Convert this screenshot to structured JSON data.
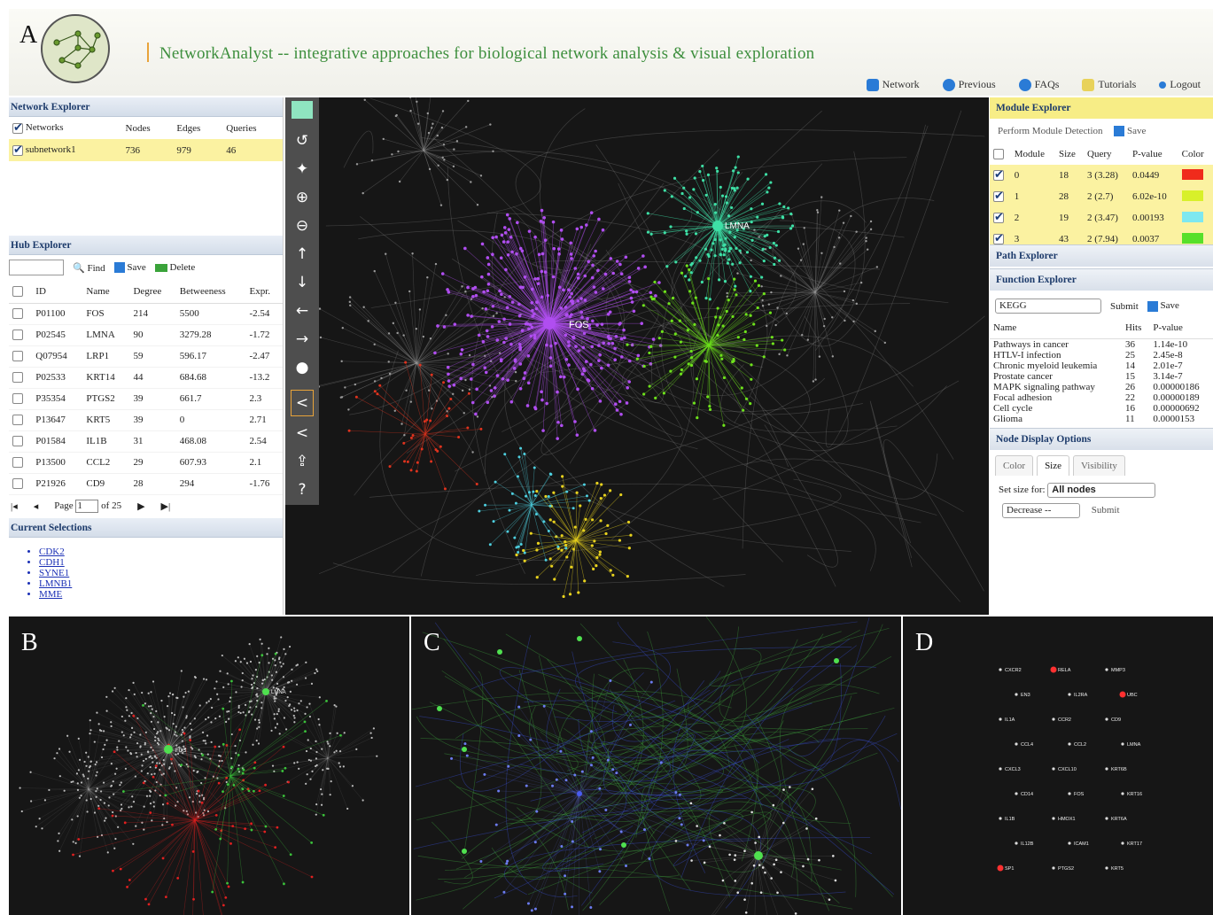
{
  "header": {
    "panel_letter": "A",
    "title": "NetworkAnalyst -- integrative approaches for biological network analysis & visual exploration",
    "nav": [
      {
        "label": "Network",
        "icon": "network-icon",
        "color": "#2a7bd6"
      },
      {
        "label": "Previous",
        "icon": "back-icon",
        "color": "#2a7bd6"
      },
      {
        "label": "FAQs",
        "icon": "help-icon",
        "color": "#2a7bd6"
      },
      {
        "label": "Tutorials",
        "icon": "document-icon",
        "color": "#e8d25a"
      },
      {
        "label": "Logout",
        "icon": "logout-icon",
        "color": "#2a7bd6"
      }
    ]
  },
  "network_explorer": {
    "title": "Network Explorer",
    "columns": [
      "Networks",
      "Nodes",
      "Edges",
      "Queries"
    ],
    "rows": [
      {
        "name": "subnetwork1",
        "nodes": "736",
        "edges": "979",
        "queries": "46"
      }
    ]
  },
  "hub_explorer": {
    "title": "Hub Explorer",
    "find_label": "Find",
    "save_label": "Save",
    "delete_label": "Delete",
    "columns": [
      "ID",
      "Name",
      "Degree",
      "Betweeness",
      "Expr."
    ],
    "rows": [
      [
        "P01100",
        "FOS",
        "214",
        "5500",
        "-2.54"
      ],
      [
        "P02545",
        "LMNA",
        "90",
        "3279.28",
        "-1.72"
      ],
      [
        "Q07954",
        "LRP1",
        "59",
        "596.17",
        "-2.47"
      ],
      [
        "P02533",
        "KRT14",
        "44",
        "684.68",
        "-13.2"
      ],
      [
        "P35354",
        "PTGS2",
        "39",
        "661.7",
        "2.3"
      ],
      [
        "P13647",
        "KRT5",
        "39",
        "0",
        "2.71"
      ],
      [
        "P01584",
        "IL1B",
        "31",
        "468.08",
        "2.54"
      ],
      [
        "P13500",
        "CCL2",
        "29",
        "607.93",
        "2.1"
      ],
      [
        "P21926",
        "CD9",
        "28",
        "294",
        "-1.76"
      ]
    ],
    "page_label": "Page",
    "page_value": "1",
    "of_label": "of 25"
  },
  "current_selections": {
    "title": "Current Selections",
    "items": [
      "CDK2",
      "CDH1",
      "SYNE1",
      "LMNB1",
      "MME"
    ]
  },
  "network": {
    "hubs": [
      {
        "label": "FOS",
        "color": "#b04ef0"
      },
      {
        "label": "LMNA",
        "color": "#3ee0a6"
      }
    ]
  },
  "module_explorer": {
    "title": "Module Explorer",
    "action_label": "Perform Module Detection",
    "save_label": "Save",
    "columns": [
      "Module",
      "Size",
      "Query",
      "P-value",
      "Color"
    ],
    "rows": [
      {
        "module": "0",
        "size": "18",
        "query": "3 (3.28)",
        "pvalue": "0.0449",
        "color": "#f02b1c"
      },
      {
        "module": "1",
        "size": "28",
        "query": "2 (2.7)",
        "pvalue": "6.02e-10",
        "color": "#d8f02a"
      },
      {
        "module": "2",
        "size": "19",
        "query": "2 (3.47)",
        "pvalue": "0.00193",
        "color": "#7ee8f0"
      },
      {
        "module": "3",
        "size": "43",
        "query": "2 (7.94)",
        "pvalue": "0.0037",
        "color": "#57e02a"
      }
    ]
  },
  "path_explorer": {
    "title": "Path Explorer"
  },
  "function_explorer": {
    "title": "Function Explorer",
    "db_selected": "KEGG",
    "submit_label": "Submit",
    "save_label": "Save",
    "columns": [
      "Name",
      "Hits",
      "P-value"
    ],
    "rows": [
      [
        "Pathways in cancer",
        "36",
        "1.14e-10"
      ],
      [
        "HTLV-I infection",
        "25",
        "2.45e-8"
      ],
      [
        "Chronic myeloid leukemia",
        "14",
        "2.01e-7"
      ],
      [
        "Prostate cancer",
        "15",
        "3.14e-7"
      ],
      [
        "MAPK signaling pathway",
        "26",
        "0.00000186"
      ],
      [
        "Focal adhesion",
        "22",
        "0.00000189"
      ],
      [
        "Cell cycle",
        "16",
        "0.00000692"
      ],
      [
        "Glioma",
        "11",
        "0.0000153"
      ]
    ]
  },
  "node_display": {
    "title": "Node Display Options",
    "tabs": [
      "Color",
      "Size",
      "Visibility"
    ],
    "active_tab": "Size",
    "set_size_label": "Set size for:",
    "set_size_value": "All nodes",
    "decrease_value": "Decrease --",
    "submit_label": "Submit"
  },
  "panel_b": {
    "letter": "B",
    "labels": [
      "FOS",
      "LMNA"
    ]
  },
  "panel_c": {
    "letter": "C"
  },
  "panel_d": {
    "letter": "D",
    "nodes": [
      {
        "label": "CXCR2",
        "color": "#dddddd"
      },
      {
        "label": "EN3",
        "color": "#dddddd"
      },
      {
        "label": "IL1A",
        "color": "#dddddd"
      },
      {
        "label": "CCL4",
        "color": "#dddddd"
      },
      {
        "label": "CXCL3",
        "color": "#dddddd"
      },
      {
        "label": "CD14",
        "color": "#dddddd"
      },
      {
        "label": "IL1B",
        "color": "#dddddd"
      },
      {
        "label": "IL12B",
        "color": "#dddddd"
      },
      {
        "label": "SP1",
        "color": "#ff3030"
      },
      {
        "label": "RELA",
        "color": "#ff3030"
      },
      {
        "label": "IL2RA",
        "color": "#dddddd"
      },
      {
        "label": "CCR2",
        "color": "#dddddd"
      },
      {
        "label": "CCL2",
        "color": "#dddddd"
      },
      {
        "label": "CXCL10",
        "color": "#dddddd"
      },
      {
        "label": "FOS",
        "color": "#dddddd"
      },
      {
        "label": "HMOX1",
        "color": "#dddddd"
      },
      {
        "label": "ICAM1",
        "color": "#dddddd"
      },
      {
        "label": "PTGS2",
        "color": "#dddddd"
      },
      {
        "label": "MMP3",
        "color": "#dddddd"
      },
      {
        "label": "UBC",
        "color": "#ff3030"
      },
      {
        "label": "CD9",
        "color": "#dddddd"
      },
      {
        "label": "LMNA",
        "color": "#dddddd"
      },
      {
        "label": "KRT6B",
        "color": "#dddddd"
      },
      {
        "label": "KRT16",
        "color": "#dddddd"
      },
      {
        "label": "KRT6A",
        "color": "#dddddd"
      },
      {
        "label": "KRT17",
        "color": "#dddddd"
      },
      {
        "label": "KRT5",
        "color": "#dddddd"
      }
    ]
  }
}
